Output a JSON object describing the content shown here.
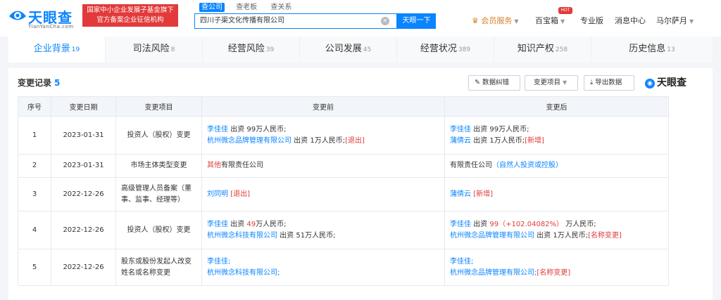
{
  "header": {
    "logo_title": "天眼查",
    "logo_sub": "TianYanCha.com",
    "gov_badge_line1": "国家中小企业发展子基金旗下",
    "gov_badge_line2": "官方备案企业征信机构",
    "search_tabs": [
      "查公司",
      "查老板",
      "查关系"
    ],
    "search_value": "四川子渠文化传播有限公司",
    "search_button": "天眼一下",
    "nav_vip": "会员服务",
    "nav_box": "百宝箱",
    "hot_badge": "HOT",
    "nav_pro": "专业版",
    "nav_msg": "消息中心",
    "nav_user": "马尔萨月"
  },
  "tabs": [
    {
      "label": "企业背景",
      "count": "19"
    },
    {
      "label": "司法风险",
      "count": "8"
    },
    {
      "label": "经营风险",
      "count": "39"
    },
    {
      "label": "公司发展",
      "count": "45"
    },
    {
      "label": "经营状况",
      "count": "389"
    },
    {
      "label": "知识产权",
      "count": "258"
    },
    {
      "label": "历史信息",
      "count": "13"
    }
  ],
  "section": {
    "title": "变更记录",
    "count": "5",
    "btn_feedback": "数据纠错",
    "btn_filter": "变更项目",
    "btn_export": "导出数据",
    "brand": "天眼查"
  },
  "table": {
    "headers": [
      "序号",
      "变更日期",
      "变更项目",
      "变更前",
      "变更后"
    ],
    "rows": [
      {
        "no": "1",
        "date": "2023-01-31",
        "item": "投资人（股权）变更",
        "before": [
          {
            "name": "李佳佳",
            "text": " 出资 99万人民币;",
            "tag": ""
          },
          {
            "name": "杭州微念品牌管理有限公司",
            "text": " 出资 1万人民币;",
            "tag": "[退出]"
          }
        ],
        "after": [
          {
            "name": "李佳佳",
            "text": " 出资 99万人民币;",
            "tag": ""
          },
          {
            "name": "蒲倩云",
            "text": " 出资 1万人民币;",
            "tag": "[新增]"
          }
        ]
      },
      {
        "no": "2",
        "date": "2023-01-31",
        "item": "市场主体类型变更",
        "before_red": "其他",
        "before_text": "有限责任公司",
        "after_text": "有限责任公司",
        "after_blue": "（自然人投资或控股）"
      },
      {
        "no": "3",
        "date": "2022-12-26",
        "item": "高级管理人员备案（董事、监事、经理等）",
        "before_name": "刘同明",
        "before_tag": "[退出]",
        "after_name": "蒲倩云",
        "after_tag": "[新增]"
      },
      {
        "no": "4",
        "date": "2022-12-26",
        "item": "投资人（股权）变更",
        "before_l1_name": "李佳佳",
        "before_l1_a": " 出资 ",
        "before_l1_amt": "49",
        "before_l1_b": "万人民币;",
        "before_l2_name": "杭州微念科技有限公司",
        "before_l2_text": " 出资 51万人民币;",
        "after_l1_name": "李佳佳",
        "after_l1_a": " 出资 ",
        "after_l1_amt": "99（+102.04082%）",
        "after_l1_b": " 万人民币;",
        "after_l2_name": "杭州微念品牌管理有限公司",
        "after_l2_text": " 出资 1万人民币;",
        "after_l2_tag": "[名称变更]"
      },
      {
        "no": "5",
        "date": "2022-12-26",
        "item": "股东或股份发起人改变姓名或名称变更",
        "before_l1": "李佳佳;",
        "before_l2": "杭州微念科技有限公司;",
        "after_l1": "李佳佳;",
        "after_l2": "杭州微念品牌管理有限公司;",
        "after_l2_tag": "[名称变更]"
      }
    ]
  },
  "colors": {
    "accent": "#0a84ff",
    "danger": "#e03a3a",
    "vip": "#d9822b"
  }
}
